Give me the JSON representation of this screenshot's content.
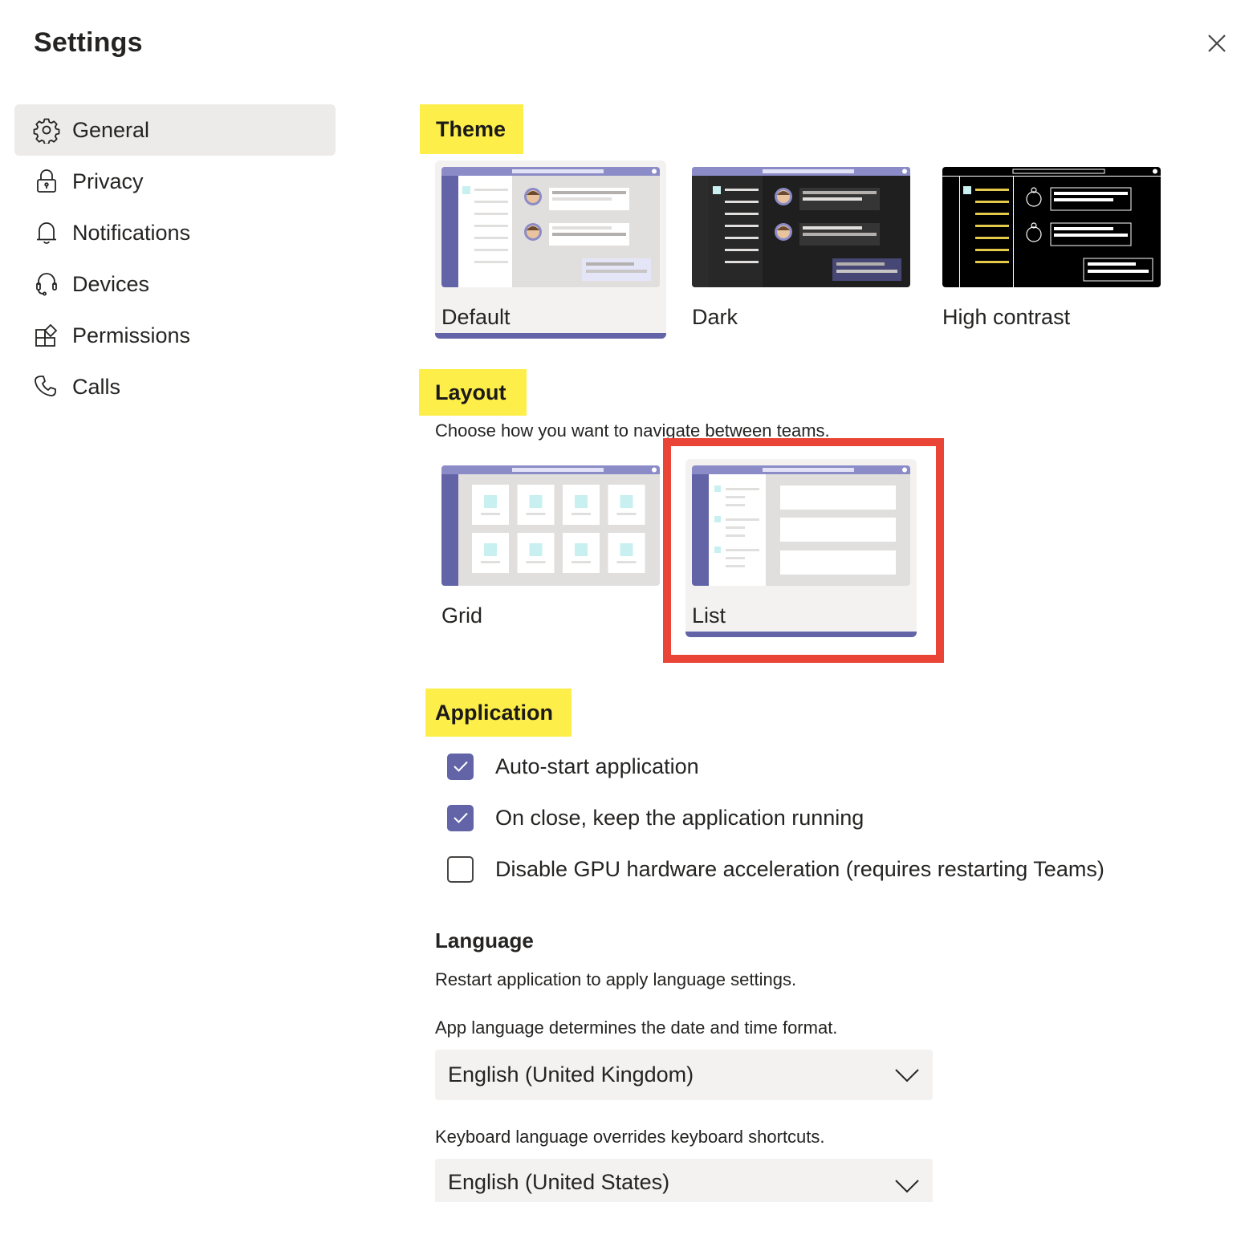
{
  "window": {
    "title": "Settings",
    "close_icon": "close-icon"
  },
  "sidebar": {
    "items": [
      {
        "label": "General",
        "icon": "gear-icon",
        "active": true
      },
      {
        "label": "Privacy",
        "icon": "lock-icon",
        "active": false
      },
      {
        "label": "Notifications",
        "icon": "bell-icon",
        "active": false
      },
      {
        "label": "Devices",
        "icon": "headset-icon",
        "active": false
      },
      {
        "label": "Permissions",
        "icon": "apps-icon",
        "active": false
      },
      {
        "label": "Calls",
        "icon": "phone-icon",
        "active": false
      }
    ]
  },
  "theme": {
    "heading": "Theme",
    "options": [
      {
        "label": "Default",
        "selected": true
      },
      {
        "label": "Dark",
        "selected": false
      },
      {
        "label": "High contrast",
        "selected": false
      }
    ]
  },
  "layout": {
    "heading": "Layout",
    "description": "Choose how you want to navigate between teams.",
    "options": [
      {
        "label": "Grid",
        "selected": false
      },
      {
        "label": "List",
        "selected": true
      }
    ]
  },
  "application": {
    "heading": "Application",
    "options": [
      {
        "label": "Auto-start application",
        "checked": true
      },
      {
        "label": "On close, keep the application running",
        "checked": true
      },
      {
        "label": "Disable GPU hardware acceleration (requires restarting Teams)",
        "checked": false
      }
    ]
  },
  "language": {
    "heading": "Language",
    "restart_note": "Restart application to apply language settings.",
    "app_language_note": "App language determines the date and time format.",
    "app_language_value": "English (United Kingdom)",
    "keyboard_language_note": "Keyboard language overrides keyboard shortcuts.",
    "keyboard_language_value": "English (United States)"
  },
  "colors": {
    "accent": "#6264a7",
    "highlight": "#fdee4a",
    "annotation_box": "#e94435",
    "selected_nav_bg": "#edebe9"
  }
}
